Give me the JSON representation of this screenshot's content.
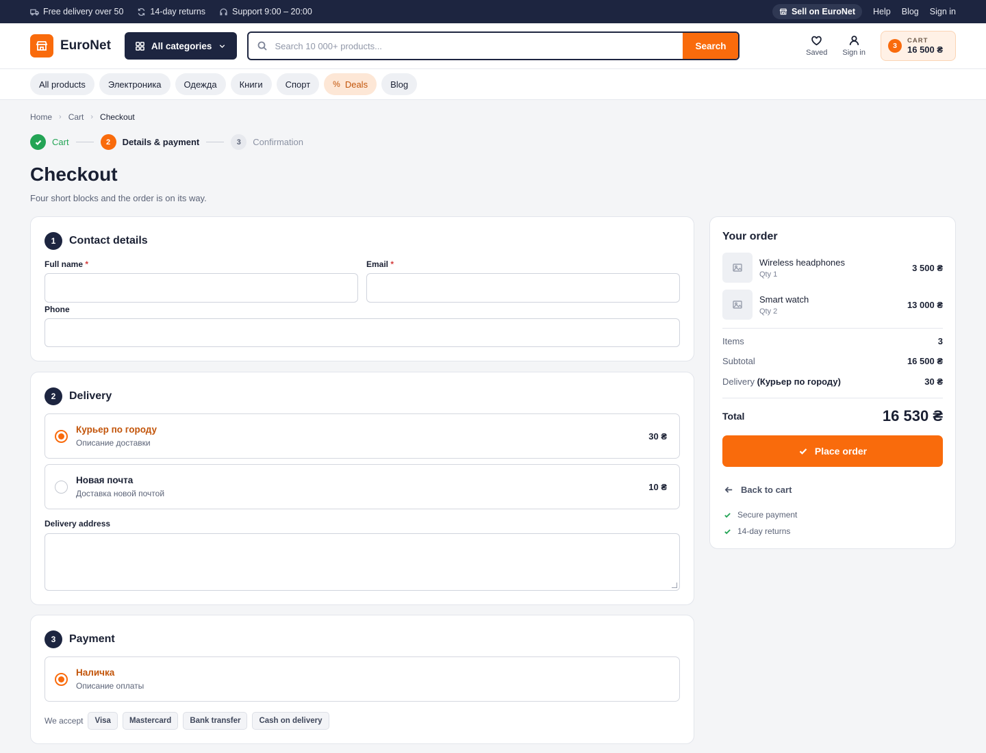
{
  "topbar": {
    "free_delivery": "Free delivery over 50",
    "returns": "14-day returns",
    "support": "Support 9:00 – 20:00",
    "sell": "Sell on EuroNet",
    "help": "Help",
    "blog": "Blog",
    "sign_in": "Sign in"
  },
  "header": {
    "logo": "EuroNet",
    "all_categories": "All categories",
    "search_placeholder": "Search 10 000+ products...",
    "search_button": "Search",
    "saved": "Saved",
    "sign_in": "Sign in",
    "cart_label": "CART",
    "cart_count": "3",
    "cart_amount": "16 500 ₴"
  },
  "nav": [
    "All products",
    "Электроника",
    "Одежда",
    "Книги",
    "Спорт",
    "Deals",
    "Blog"
  ],
  "breadcrumb": {
    "home": "Home",
    "cart": "Cart",
    "current": "Checkout"
  },
  "steps": [
    {
      "num": "",
      "label": "Cart",
      "state": "done"
    },
    {
      "num": "2",
      "label": "Details & payment",
      "state": "active"
    },
    {
      "num": "3",
      "label": "Confirmation",
      "state": "todo"
    }
  ],
  "page": {
    "title": "Checkout",
    "subtitle": "Four short blocks and the order is on its way."
  },
  "contact": {
    "num": "1",
    "title": "Contact details",
    "full_name": "Full name",
    "email": "Email",
    "phone": "Phone",
    "req": "*"
  },
  "delivery": {
    "num": "2",
    "title": "Delivery",
    "options": [
      {
        "title": "Курьер по городу",
        "desc": "Описание доставки",
        "price": "30 ₴",
        "selected": true
      },
      {
        "title": "Новая почта",
        "desc": "Доставка новой почтой",
        "price": "10 ₴",
        "selected": false
      }
    ],
    "address_label": "Delivery address"
  },
  "payment": {
    "num": "3",
    "title": "Payment",
    "option": {
      "title": "Наличка",
      "desc": "Описание оплаты"
    },
    "we_accept": "We accept",
    "methods": [
      "Visa",
      "Mastercard",
      "Bank transfer",
      "Cash on delivery"
    ]
  },
  "summary": {
    "title": "Your order",
    "items": [
      {
        "name": "Wireless headphones",
        "qty": "Qty 1",
        "price": "3 500 ₴"
      },
      {
        "name": "Smart watch",
        "qty": "Qty 2",
        "price": "13 000 ₴"
      }
    ],
    "items_label": "Items",
    "items_value": "3",
    "subtotal_label": "Subtotal",
    "subtotal_value": "16 500 ₴",
    "delivery_label": "Delivery",
    "delivery_method": "(Курьер по городу)",
    "delivery_value": "30 ₴",
    "total_label": "Total",
    "total_value": "16 530 ₴",
    "place_order": "Place order",
    "back_to_cart": "Back to cart",
    "trust": [
      "Secure payment",
      "14-day returns"
    ]
  },
  "colors": {
    "accent": "#f96b0c",
    "dark": "#1d2540",
    "success": "#23a455"
  }
}
